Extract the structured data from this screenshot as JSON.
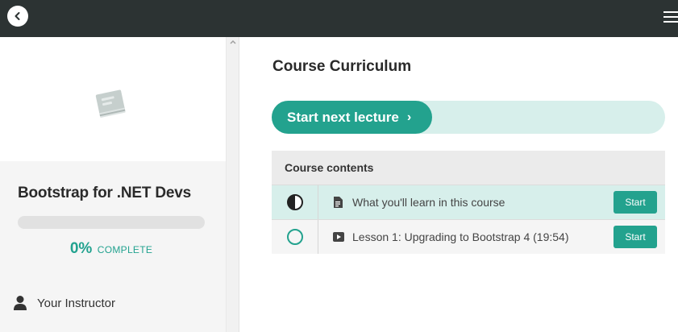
{
  "topbar": {
    "back_icon": "chevron-left-icon",
    "menu_icon": "hamburger-menu-icon"
  },
  "sidebar": {
    "course_image_icon": "book-icon",
    "course_title": "Bootstrap for .NET Devs",
    "progress_fraction": 0,
    "progress_percent": "0%",
    "progress_label": "COMPLETE",
    "instructor_icon": "user-icon",
    "instructor_label": "Your Instructor"
  },
  "main": {
    "section_title": "Course Curriculum",
    "next_lecture_label": "Start next lecture",
    "next_lecture_chevron": "›",
    "contents_header": "Course contents",
    "lessons": [
      {
        "status_icon": "half-circle-icon",
        "type_icon": "document-icon",
        "title": "What you'll learn in this course",
        "button": "Start",
        "highlighted": true
      },
      {
        "status_icon": "empty-circle-icon",
        "type_icon": "video-icon",
        "title": "Lesson 1: Upgrading to Bootstrap 4 (19:54)",
        "button": "Start",
        "highlighted": false
      }
    ]
  },
  "colors": {
    "accent": "#23a28e",
    "accent_light": "#d7efeb",
    "topbar": "#2c3333"
  }
}
